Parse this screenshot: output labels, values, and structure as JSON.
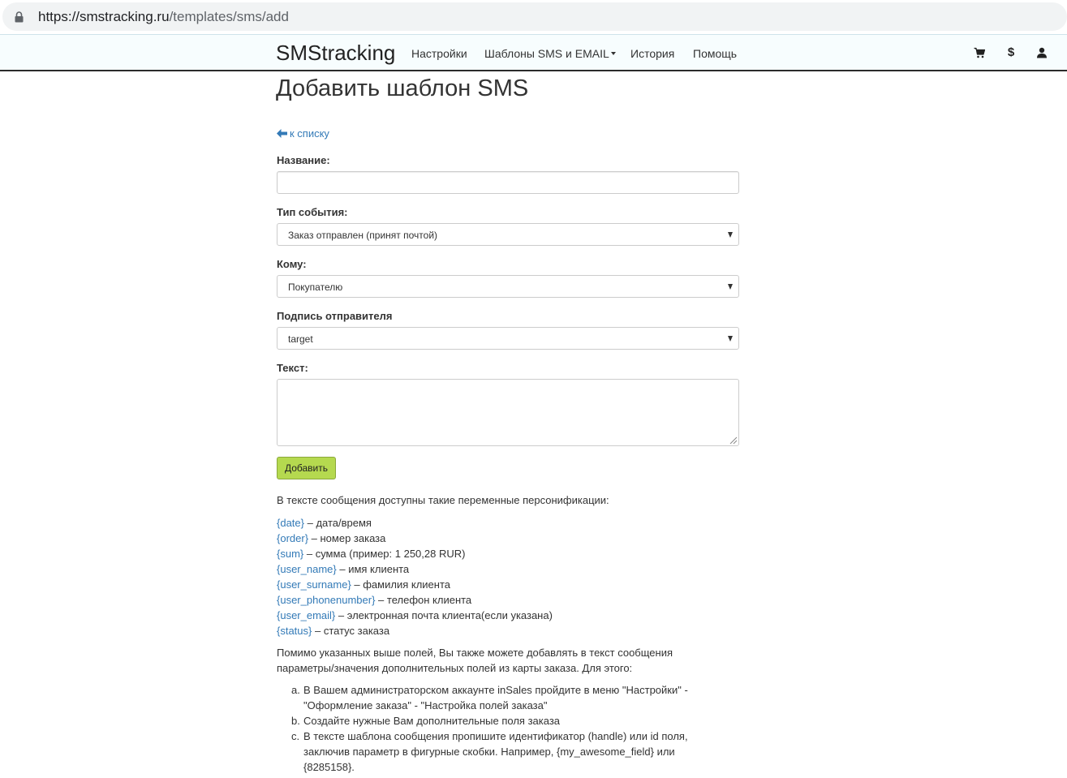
{
  "browser": {
    "url_host": "https://smstracking.ru",
    "url_path": "/templates/sms/add"
  },
  "navbar": {
    "brand": "SMStracking",
    "items": [
      {
        "label": "Настройки"
      },
      {
        "label": "Шаблоны SMS и EMAIL"
      },
      {
        "label": "История"
      },
      {
        "label": "Помощь"
      }
    ],
    "icons": [
      "cart-icon",
      "dollar-icon",
      "user-icon"
    ],
    "dollar_symbol": "$"
  },
  "page": {
    "title": "Добавить шаблон SMS",
    "back_link": "к списку"
  },
  "form": {
    "name_label": "Название:",
    "name_value": "",
    "event_label": "Тип события:",
    "event_value": "Заказ отправлен (принят почтой)",
    "recipient_label": "Кому:",
    "recipient_value": "Покупателю",
    "sender_label": "Подпись отправителя",
    "sender_value": "target",
    "text_label": "Текст:",
    "text_value": "",
    "submit_label": "Добавить"
  },
  "help": {
    "intro": "В тексте сообщения доступны такие переменные персонификации:",
    "variables": [
      {
        "name": "{date}",
        "desc": " – дата/время"
      },
      {
        "name": "{order}",
        "desc": " – номер заказа"
      },
      {
        "name": "{sum}",
        "desc": " – сумма (пример: 1 250,28 RUR)"
      },
      {
        "name": "{user_name}",
        "desc": " – имя клиента"
      },
      {
        "name": "{user_surname}",
        "desc": " – фамилия клиента"
      },
      {
        "name": "{user_phonenumber}",
        "desc": " – телефон клиента"
      },
      {
        "name": "{user_email}",
        "desc": " – электронная почта клиента(если указана)"
      },
      {
        "name": "{status}",
        "desc": " – статус заказа"
      }
    ],
    "extra": "Помимо указанных выше полей, Вы также можете добавлять в текст сообщения параметры/значения дополнительных полей из карты заказа. Для этого:",
    "steps": [
      {
        "mark": "a.",
        "text": "В Вашем администраторском аккаунте inSales пройдите в меню \"Настройки\" - \"Оформление заказа\" - \"Настройка полей заказа\""
      },
      {
        "mark": "b.",
        "text": "Создайте нужные Вам дополнительные поля заказа"
      },
      {
        "mark": "c.",
        "text": "В тексте шаблона сообщения пропишите идентификатор (handle) или id поля, заключив параметр в фигурные скобки. Например, {my_awesome_field} или {8285158}."
      }
    ]
  },
  "colors": {
    "link": "#337ab7",
    "button": "#b5d94f",
    "navbar_bg": "#f7fdfe"
  }
}
